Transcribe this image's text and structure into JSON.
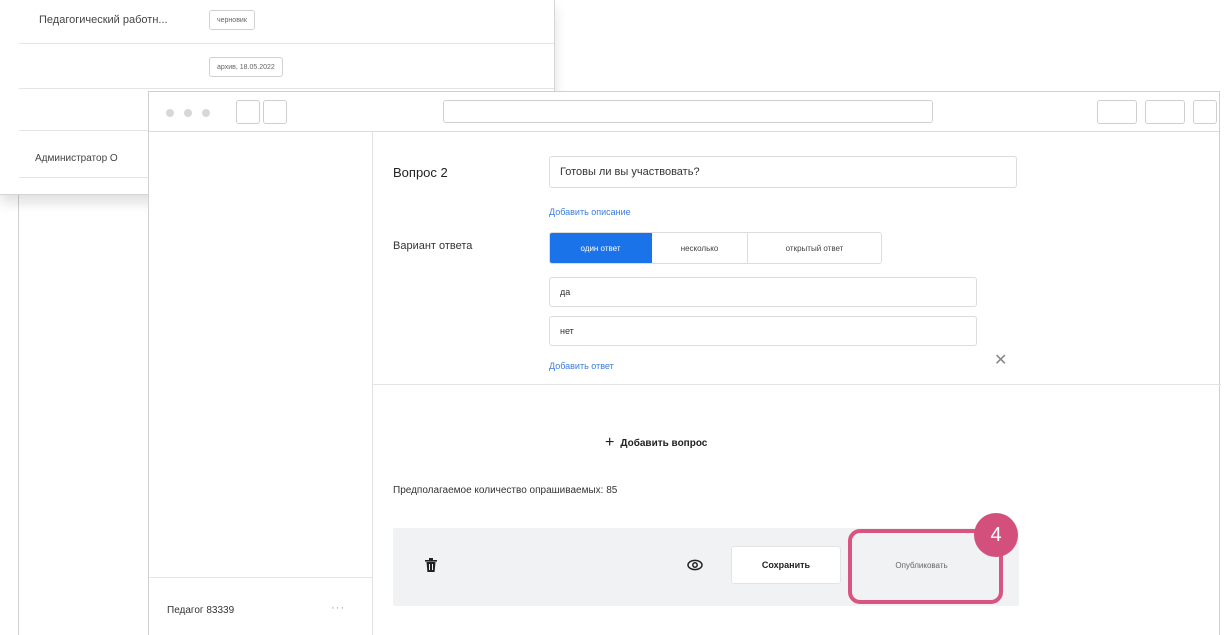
{
  "background_window": {
    "row1_title": "Педагогический работн...",
    "row1_status": "черновик",
    "row2_deadline": "архив, 18.05.2022",
    "row3_title": "Администратор О"
  },
  "sidebar": {
    "user_name": "Педагог 83339",
    "more_label": "···"
  },
  "question": {
    "label": "Вопрос 2",
    "text": "Готовы ли вы участвовать?",
    "add_description_link": "Добавить описание"
  },
  "answer_variant": {
    "label": "Вариант ответа",
    "options": [
      "один ответ",
      "несколько",
      "открытый ответ"
    ],
    "selected_index": 0,
    "answers": [
      "да",
      "нет"
    ],
    "remove_icon": "close-icon",
    "add_answer_link": "Добавить ответ"
  },
  "add_question": {
    "plus": "+",
    "label": "Добавить вопрос"
  },
  "estimate_text": "Предполагаемое количество опрашиваемых: 85",
  "actions": {
    "delete_icon": "trash-icon",
    "preview_icon": "eye-icon",
    "save_label": "Сохранить",
    "publish_label": "Опубликовать"
  },
  "annotation": {
    "step": "4",
    "highlight_color": "#d9557f"
  },
  "colors": {
    "accent": "#1a73e8",
    "link": "#3b7ddd",
    "action_bar_bg": "#f1f2f4"
  }
}
